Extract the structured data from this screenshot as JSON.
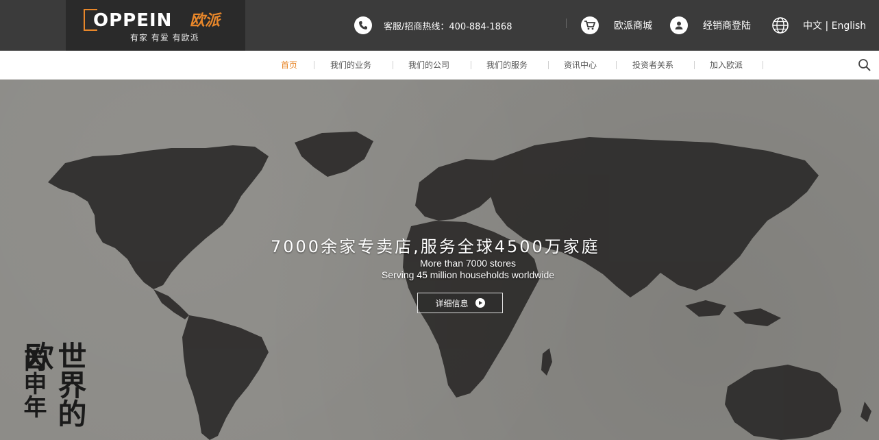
{
  "header": {
    "logo_word": "OPPEIN",
    "logo_cn": "欧派",
    "slogan": "有家 有爱 有欧派",
    "hotline": "客服/招商热线：400-884-1868",
    "mall": "欧派商城",
    "dealer_login": "经销商登陆",
    "language": "中文 | English"
  },
  "nav": {
    "items": [
      {
        "label": "首页"
      },
      {
        "label": "我们的业务"
      },
      {
        "label": "我们的公司"
      },
      {
        "label": "我们的服务"
      },
      {
        "label": "资讯中心"
      },
      {
        "label": "投资者关系"
      },
      {
        "label": "加入欧派"
      }
    ]
  },
  "hero": {
    "headline_cn": "7000余家专卖店,服务全球4500万家庭",
    "headline_en_1": "More than 7000 stores",
    "headline_en_2": "Serving 45 million households worldwide",
    "detail_button": "详细信息",
    "calligraphy_left": "丙申年",
    "calligraphy_right": "世界的欧"
  },
  "colors": {
    "accent": "#e8872a",
    "topbar": "#3b3b3b",
    "hero_bg": "#8b8a86"
  },
  "icons": [
    "phone-icon",
    "cart-icon",
    "user-icon",
    "globe-icon",
    "search-icon",
    "play-icon"
  ]
}
